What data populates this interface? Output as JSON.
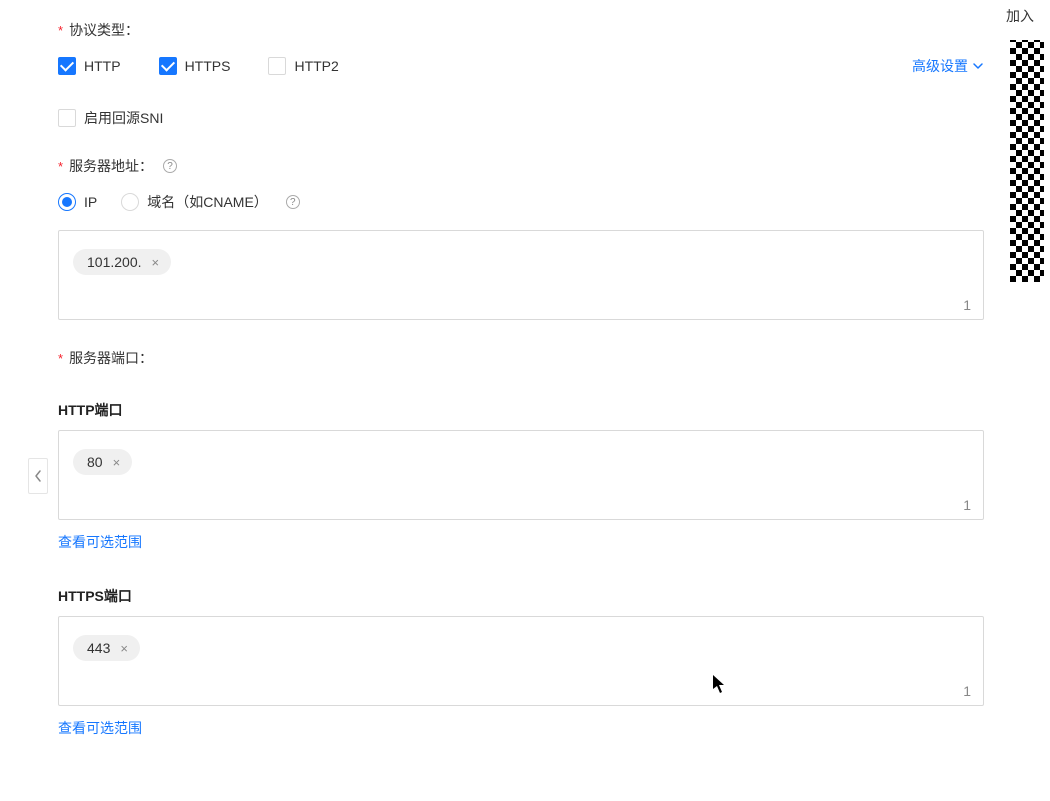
{
  "protocol": {
    "label": "协议类型：",
    "options": {
      "http": {
        "label": "HTTP",
        "checked": true
      },
      "https": {
        "label": "HTTPS",
        "checked": true
      },
      "http2": {
        "label": "HTTP2",
        "checked": false
      }
    },
    "advanced_label": "高级设置"
  },
  "sni": {
    "label": "启用回源SNI",
    "checked": false
  },
  "server_address": {
    "label": "服务器地址：",
    "radios": {
      "ip": {
        "label": "IP",
        "selected": true
      },
      "domain": {
        "label": "域名（如CNAME）",
        "selected": false
      }
    },
    "values": [
      "101.200."
    ],
    "count": "1"
  },
  "server_port": {
    "label": "服务器端口：",
    "http": {
      "heading": "HTTP端口",
      "values": [
        "80"
      ],
      "count": "1",
      "range_link": "查看可选范围"
    },
    "https": {
      "heading": "HTTPS端口",
      "values": [
        "443"
      ],
      "count": "1",
      "range_link": "查看可选范围"
    }
  },
  "side": {
    "join_label": "加入"
  },
  "glyphs": {
    "tag_close": "×"
  }
}
